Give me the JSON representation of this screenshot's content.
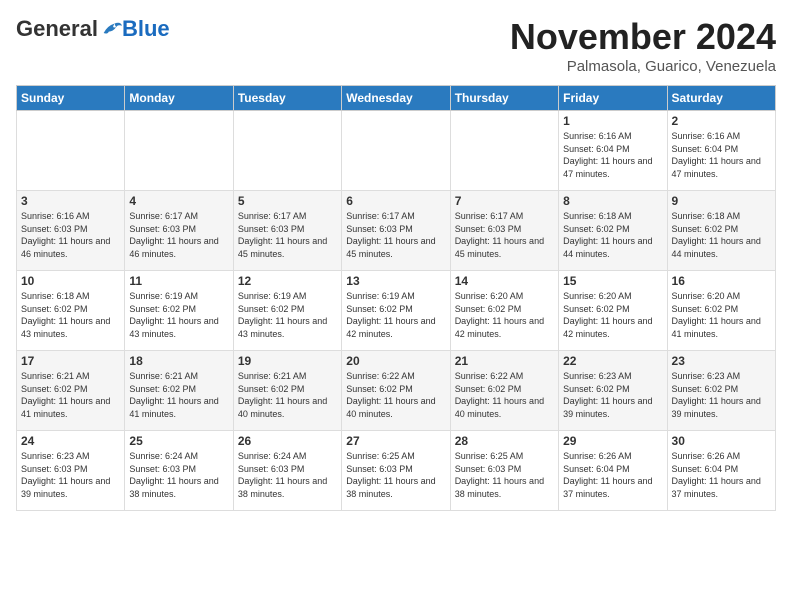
{
  "header": {
    "logo_general": "General",
    "logo_blue": "Blue",
    "month_title": "November 2024",
    "location": "Palmasola, Guarico, Venezuela"
  },
  "weekdays": [
    "Sunday",
    "Monday",
    "Tuesday",
    "Wednesday",
    "Thursday",
    "Friday",
    "Saturday"
  ],
  "weeks": [
    [
      {
        "day": "",
        "info": ""
      },
      {
        "day": "",
        "info": ""
      },
      {
        "day": "",
        "info": ""
      },
      {
        "day": "",
        "info": ""
      },
      {
        "day": "",
        "info": ""
      },
      {
        "day": "1",
        "info": "Sunrise: 6:16 AM\nSunset: 6:04 PM\nDaylight: 11 hours and 47 minutes."
      },
      {
        "day": "2",
        "info": "Sunrise: 6:16 AM\nSunset: 6:04 PM\nDaylight: 11 hours and 47 minutes."
      }
    ],
    [
      {
        "day": "3",
        "info": "Sunrise: 6:16 AM\nSunset: 6:03 PM\nDaylight: 11 hours and 46 minutes."
      },
      {
        "day": "4",
        "info": "Sunrise: 6:17 AM\nSunset: 6:03 PM\nDaylight: 11 hours and 46 minutes."
      },
      {
        "day": "5",
        "info": "Sunrise: 6:17 AM\nSunset: 6:03 PM\nDaylight: 11 hours and 45 minutes."
      },
      {
        "day": "6",
        "info": "Sunrise: 6:17 AM\nSunset: 6:03 PM\nDaylight: 11 hours and 45 minutes."
      },
      {
        "day": "7",
        "info": "Sunrise: 6:17 AM\nSunset: 6:03 PM\nDaylight: 11 hours and 45 minutes."
      },
      {
        "day": "8",
        "info": "Sunrise: 6:18 AM\nSunset: 6:02 PM\nDaylight: 11 hours and 44 minutes."
      },
      {
        "day": "9",
        "info": "Sunrise: 6:18 AM\nSunset: 6:02 PM\nDaylight: 11 hours and 44 minutes."
      }
    ],
    [
      {
        "day": "10",
        "info": "Sunrise: 6:18 AM\nSunset: 6:02 PM\nDaylight: 11 hours and 43 minutes."
      },
      {
        "day": "11",
        "info": "Sunrise: 6:19 AM\nSunset: 6:02 PM\nDaylight: 11 hours and 43 minutes."
      },
      {
        "day": "12",
        "info": "Sunrise: 6:19 AM\nSunset: 6:02 PM\nDaylight: 11 hours and 43 minutes."
      },
      {
        "day": "13",
        "info": "Sunrise: 6:19 AM\nSunset: 6:02 PM\nDaylight: 11 hours and 42 minutes."
      },
      {
        "day": "14",
        "info": "Sunrise: 6:20 AM\nSunset: 6:02 PM\nDaylight: 11 hours and 42 minutes."
      },
      {
        "day": "15",
        "info": "Sunrise: 6:20 AM\nSunset: 6:02 PM\nDaylight: 11 hours and 42 minutes."
      },
      {
        "day": "16",
        "info": "Sunrise: 6:20 AM\nSunset: 6:02 PM\nDaylight: 11 hours and 41 minutes."
      }
    ],
    [
      {
        "day": "17",
        "info": "Sunrise: 6:21 AM\nSunset: 6:02 PM\nDaylight: 11 hours and 41 minutes."
      },
      {
        "day": "18",
        "info": "Sunrise: 6:21 AM\nSunset: 6:02 PM\nDaylight: 11 hours and 41 minutes."
      },
      {
        "day": "19",
        "info": "Sunrise: 6:21 AM\nSunset: 6:02 PM\nDaylight: 11 hours and 40 minutes."
      },
      {
        "day": "20",
        "info": "Sunrise: 6:22 AM\nSunset: 6:02 PM\nDaylight: 11 hours and 40 minutes."
      },
      {
        "day": "21",
        "info": "Sunrise: 6:22 AM\nSunset: 6:02 PM\nDaylight: 11 hours and 40 minutes."
      },
      {
        "day": "22",
        "info": "Sunrise: 6:23 AM\nSunset: 6:02 PM\nDaylight: 11 hours and 39 minutes."
      },
      {
        "day": "23",
        "info": "Sunrise: 6:23 AM\nSunset: 6:02 PM\nDaylight: 11 hours and 39 minutes."
      }
    ],
    [
      {
        "day": "24",
        "info": "Sunrise: 6:23 AM\nSunset: 6:03 PM\nDaylight: 11 hours and 39 minutes."
      },
      {
        "day": "25",
        "info": "Sunrise: 6:24 AM\nSunset: 6:03 PM\nDaylight: 11 hours and 38 minutes."
      },
      {
        "day": "26",
        "info": "Sunrise: 6:24 AM\nSunset: 6:03 PM\nDaylight: 11 hours and 38 minutes."
      },
      {
        "day": "27",
        "info": "Sunrise: 6:25 AM\nSunset: 6:03 PM\nDaylight: 11 hours and 38 minutes."
      },
      {
        "day": "28",
        "info": "Sunrise: 6:25 AM\nSunset: 6:03 PM\nDaylight: 11 hours and 38 minutes."
      },
      {
        "day": "29",
        "info": "Sunrise: 6:26 AM\nSunset: 6:04 PM\nDaylight: 11 hours and 37 minutes."
      },
      {
        "day": "30",
        "info": "Sunrise: 6:26 AM\nSunset: 6:04 PM\nDaylight: 11 hours and 37 minutes."
      }
    ]
  ]
}
